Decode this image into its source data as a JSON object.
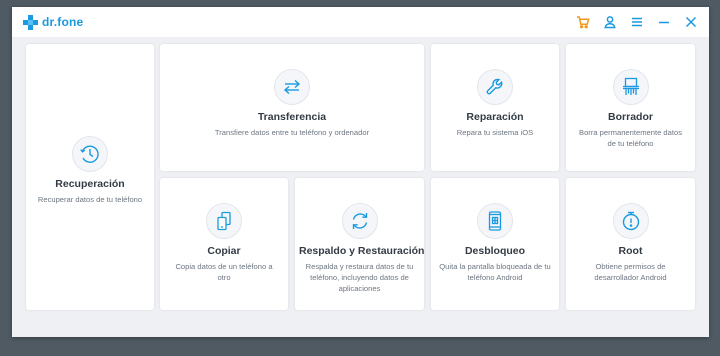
{
  "app": {
    "name": "dr.fone",
    "brand_color": "#1a9ae0",
    "accent_color": "#f39a1e"
  },
  "titlebar": {
    "icons": [
      "cart-icon",
      "account-icon",
      "menu-icon",
      "minimize-icon",
      "close-icon"
    ]
  },
  "modules": {
    "recuperacion": {
      "title": "Recuperación",
      "desc": "Recuperar datos de tu teléfono",
      "icon": "clock-icon"
    },
    "transferencia": {
      "title": "Transferencia",
      "desc": "Transfiere datos entre tu teléfono y ordenador",
      "icon": "transfer-arrows-icon"
    },
    "reparacion": {
      "title": "Reparación",
      "desc": "Repara tu sistema iOS",
      "icon": "wrench-icon"
    },
    "borrador": {
      "title": "Borrador",
      "desc": "Borra permanentemente datos de tu teléfono",
      "icon": "shredder-icon"
    },
    "copiar": {
      "title": "Copiar",
      "desc": "Copia datos de un teléfono a otro",
      "icon": "phone-copy-icon"
    },
    "respaldo": {
      "title": "Respaldo y Restauración",
      "desc": "Respalda y restaura datos de tu teléfono, incluyendo datos de aplicaciones",
      "icon": "sync-icon"
    },
    "desbloqueo": {
      "title": "Desbloqueo",
      "desc": "Quita la pantalla bloqueada de tu teléfono Android",
      "icon": "phone-lock-icon"
    },
    "root": {
      "title": "Root",
      "desc": "Obtiene permisos de desarrollador Android",
      "icon": "root-timer-icon"
    }
  }
}
